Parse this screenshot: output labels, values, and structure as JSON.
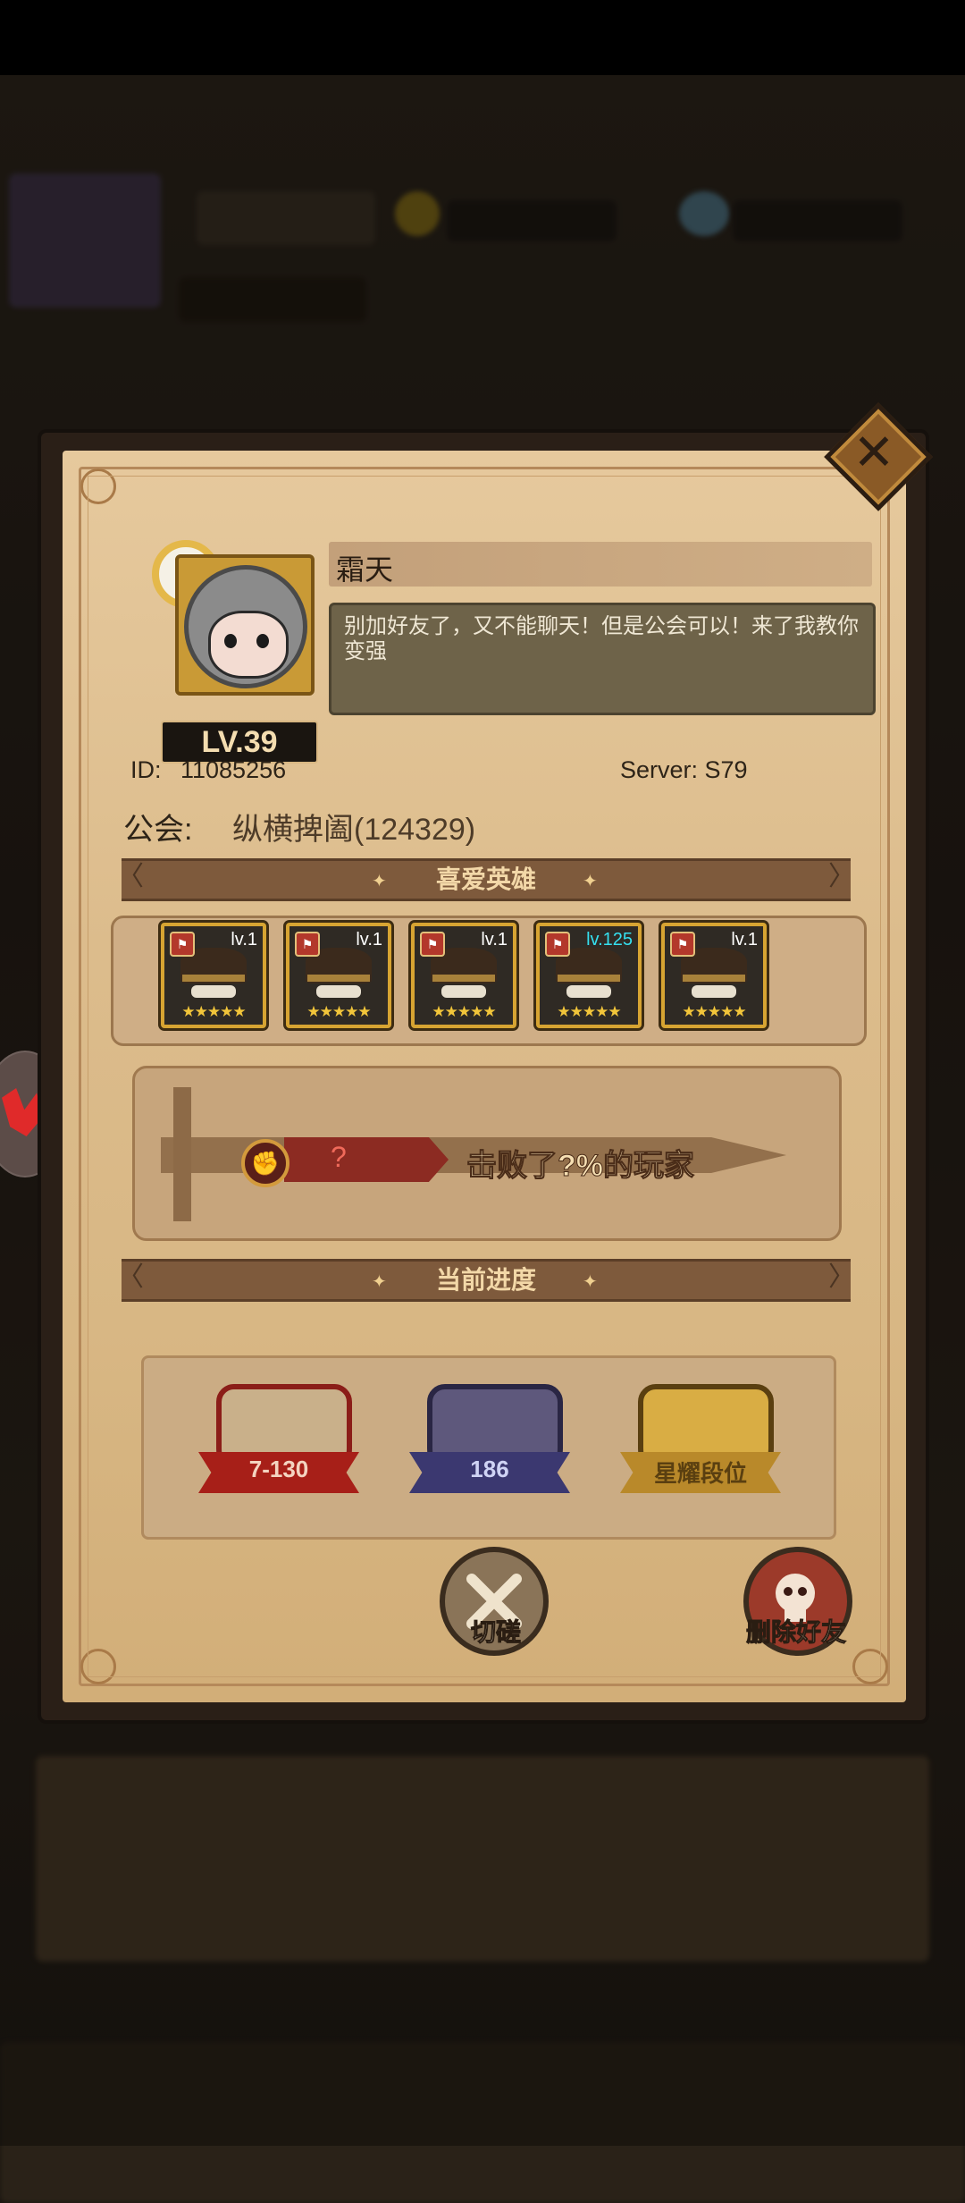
{
  "profile": {
    "name": "霜天",
    "signature": "别加好友了，又不能聊天！但是公会可以！来了我教你变强",
    "level": "LV.39",
    "id_label": "ID:",
    "id_value": "11085256",
    "server": "Server: S79",
    "guild_label": "公会:",
    "guild_name": "纵横捭阖(124329)"
  },
  "sections": {
    "favorite_heroes": "喜爱英雄",
    "current_progress": "当前进度"
  },
  "heroes": [
    {
      "level": "lv.1",
      "stars": "★★★★★"
    },
    {
      "level": "lv.1",
      "stars": "★★★★★"
    },
    {
      "level": "lv.1",
      "stars": "★★★★★"
    },
    {
      "level": "lv.125",
      "stars": "★★★★★"
    },
    {
      "level": "lv.1",
      "stars": "★★★★★"
    }
  ],
  "ranking": {
    "rank": "?",
    "defeated_text": "击败了?%的玩家"
  },
  "progress": [
    {
      "label": "7-130",
      "color": "#b3261e"
    },
    {
      "label": "186",
      "color": "#5a5aa8"
    },
    {
      "label": "星耀段位",
      "color": "#d6a632"
    }
  ],
  "actions": {
    "spar": "切磋",
    "delete_friend": "删除好友"
  },
  "icons": {
    "close": "close-icon",
    "spar": "crossed-swords-icon",
    "delete": "skull-icon"
  }
}
